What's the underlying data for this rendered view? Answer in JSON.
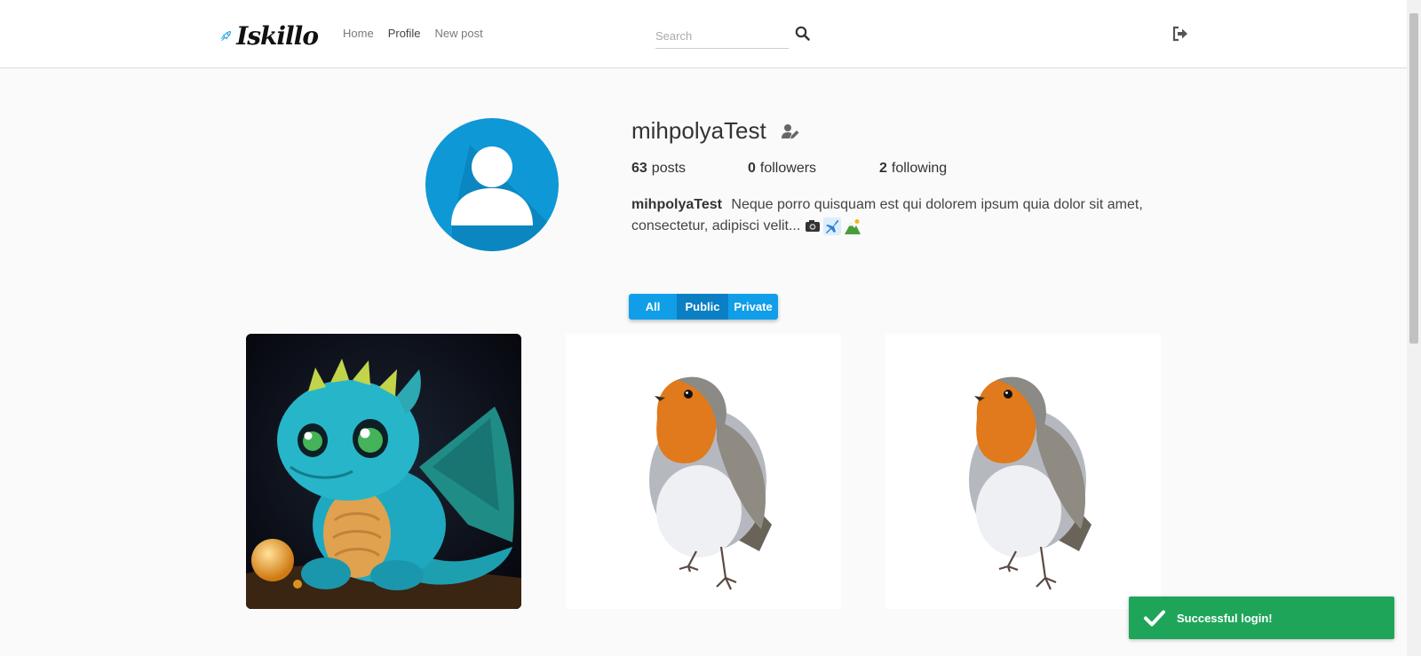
{
  "header": {
    "logo_text": "Iskillo",
    "nav": [
      {
        "label": "Home",
        "active": false
      },
      {
        "label": "Profile",
        "active": true
      },
      {
        "label": "New post",
        "active": false
      }
    ],
    "search": {
      "placeholder": "Search",
      "value": ""
    },
    "icons": {
      "search": "search-icon",
      "logout": "logout-icon"
    }
  },
  "profile": {
    "username": "mihpolyaTest",
    "stats": {
      "posts_count": "63",
      "posts_label": "posts",
      "followers_count": "0",
      "followers_label": "followers",
      "following_count": "2",
      "following_label": "following"
    },
    "bio_user": "mihpolyaTest",
    "bio_text": "Neque porro quisquam est qui dolorem ipsum quia dolor sit amet, consectetur, adipisci velit...",
    "bio_emojis": [
      "camera-emoji",
      "airplane-emoji",
      "mountain-emoji"
    ]
  },
  "filter": {
    "options": [
      "All",
      "Public",
      "Private"
    ],
    "selected": "Public"
  },
  "posts": [
    {
      "subject": "baby-dragon-image"
    },
    {
      "subject": "robin-bird-image"
    },
    {
      "subject": "robin-bird-image"
    }
  ],
  "toast": {
    "message": "Successful login!",
    "icon": "check-icon"
  },
  "colors": {
    "accent": "#119ee8",
    "accent_selected": "#0a7fc4",
    "avatar_bg": "#0f98d6",
    "toast_bg": "#1fa55a"
  }
}
